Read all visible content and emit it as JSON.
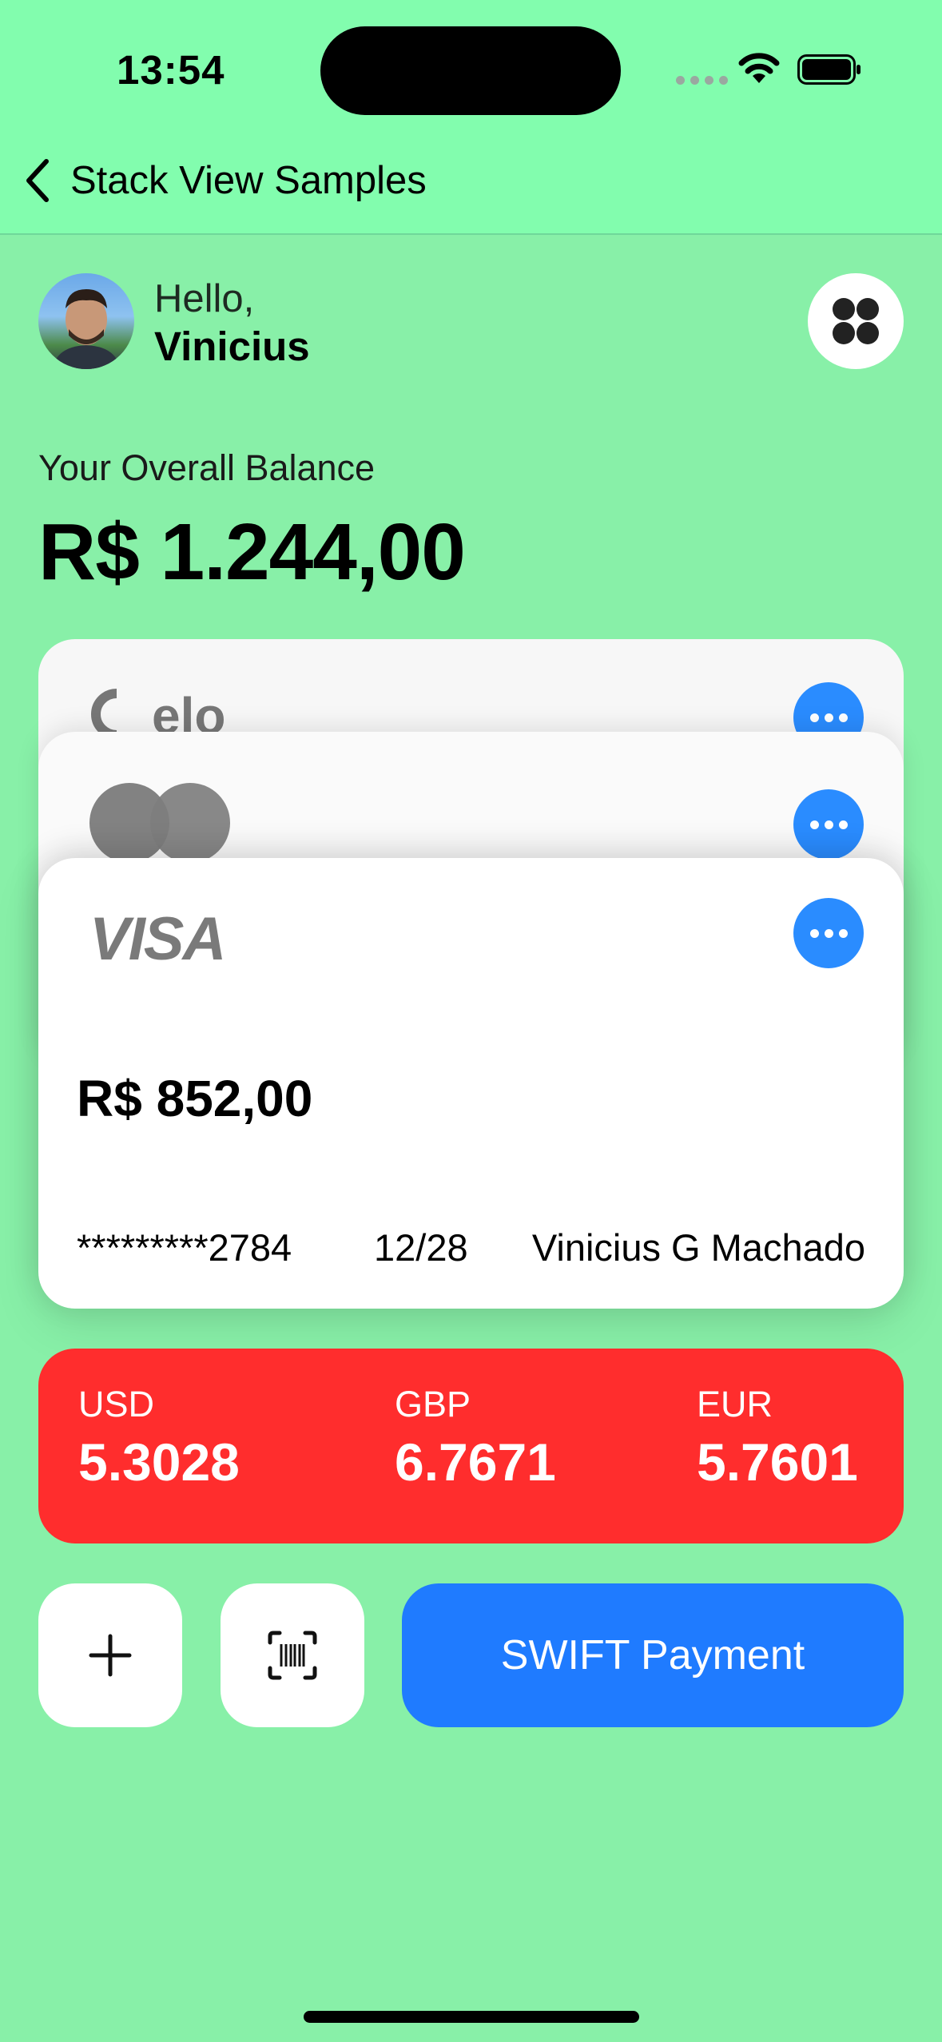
{
  "status_bar": {
    "time": "13:54"
  },
  "nav": {
    "title": "Stack View Samples",
    "back_icon": "chevron-left-icon"
  },
  "header": {
    "greeting": "Hello,",
    "name": "Vinicius",
    "menu_icon": "grid-dots-icon"
  },
  "balance": {
    "label": "Your Overall Balance",
    "amount": "R$ 1.244,00"
  },
  "cards": {
    "elo": {
      "brand": "elo"
    },
    "mastercard": {
      "brand": "mastercard"
    },
    "visa": {
      "brand": "VISA",
      "amount": "R$ 852,00",
      "number": "*********2784",
      "expiry": "12/28",
      "holder": "Vinicius G Machado"
    }
  },
  "rates": [
    {
      "code": "USD",
      "value": "5.3028"
    },
    {
      "code": "GBP",
      "value": "6.7671"
    },
    {
      "code": "EUR",
      "value": "5.7601"
    }
  ],
  "actions": {
    "add_icon": "plus-icon",
    "scan_icon": "barcode-scan-icon",
    "swift_label": "SWIFT Payment"
  },
  "colors": {
    "background": "#88F0A8",
    "nav": "#82FDAE",
    "accent_blue": "#1F7BFF",
    "rates_red": "#FF2D2D"
  }
}
